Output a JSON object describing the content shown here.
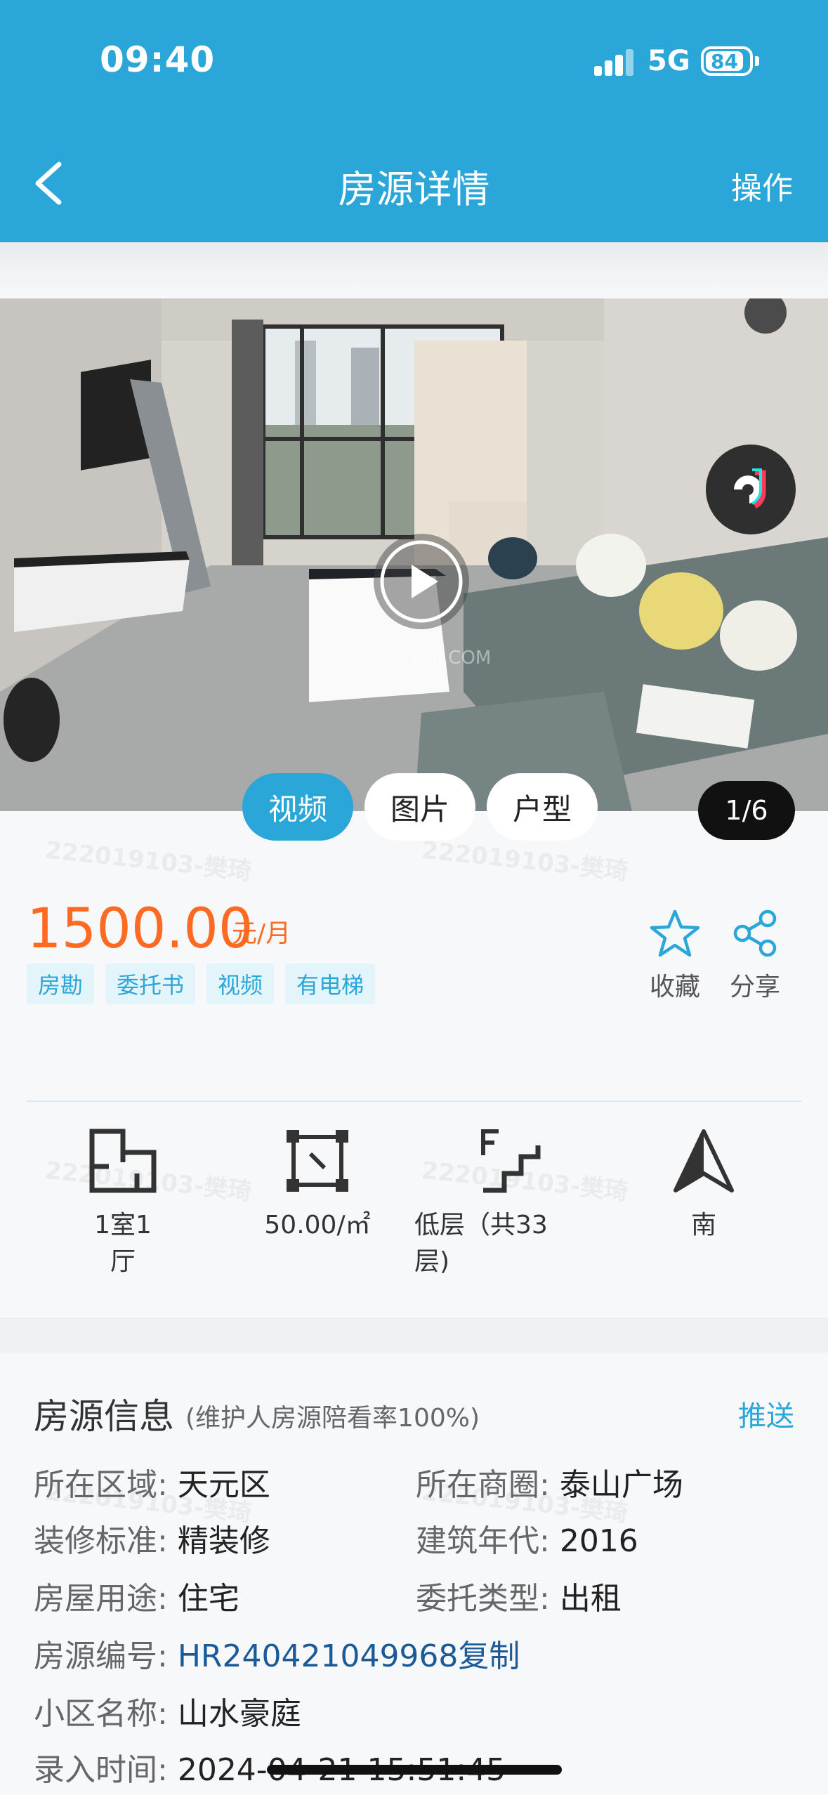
{
  "status": {
    "time": "09:40",
    "network": "5G",
    "battery": "84"
  },
  "header": {
    "title": "房源详情",
    "action": "操作"
  },
  "gallery": {
    "tabs": [
      {
        "label": "视频",
        "active": true
      },
      {
        "label": "图片",
        "active": false
      },
      {
        "label": "户型",
        "active": false
      }
    ],
    "counter": "1/6"
  },
  "watermark": "222019103-樊琦",
  "price": {
    "value": "1500.00",
    "unit": "元/月"
  },
  "tags": [
    "房勘",
    "委托书",
    "视频",
    "有电梯"
  ],
  "actions": {
    "favorite": "收藏",
    "share": "分享"
  },
  "features": [
    {
      "icon": "floorplan-icon",
      "label": "1室1厅"
    },
    {
      "icon": "area-icon",
      "label": "50.00/㎡"
    },
    {
      "icon": "floor-stairs-icon",
      "label_line1": "低层（共33",
      "label_line2": "层)"
    },
    {
      "icon": "orientation-icon",
      "label": "南"
    }
  ],
  "info": {
    "title": "房源信息",
    "subtitle": "(维护人房源陪看率100%)",
    "push": "推送",
    "rows": [
      {
        "k1": "所在区域:",
        "v1": "天元区",
        "k2": "所在商圈:",
        "v2": "泰山广场"
      },
      {
        "k1": "装修标准:",
        "v1": "精装修",
        "k2": "建筑年代:",
        "v2": "2016"
      },
      {
        "k1": "房屋用途:",
        "v1": "住宅",
        "k2": "委托类型:",
        "v2": "出租"
      }
    ],
    "house_no_key": "房源编号:",
    "house_no": "HR240421049968",
    "copy": "复制",
    "community_key": "小区名称:",
    "community": "山水豪庭",
    "entry_time_key": "录入时间:",
    "entry_time": "2024-04-21 15:51:45"
  },
  "colors": {
    "primary": "#2aa6d8",
    "price": "#ff6a22",
    "link": "#1a5a98"
  }
}
